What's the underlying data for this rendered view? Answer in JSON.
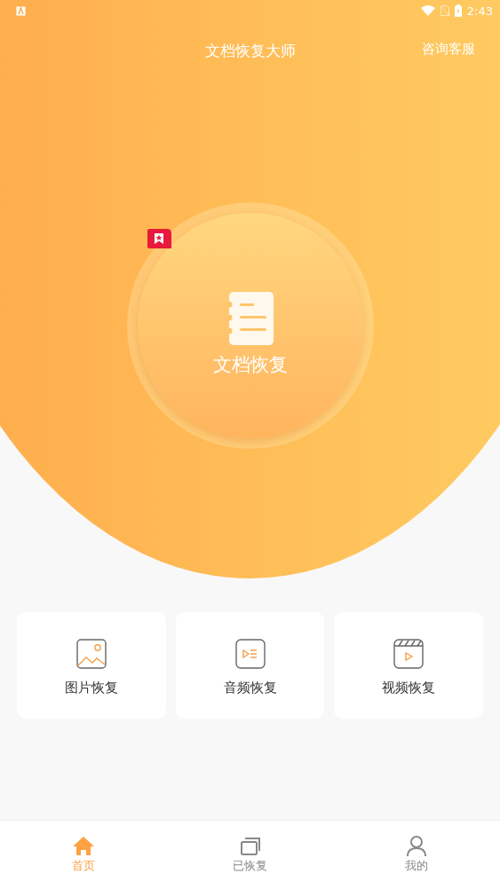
{
  "status_bar": {
    "time": "2:43"
  },
  "header": {
    "title": "文档恢复大师",
    "action": "咨询客服"
  },
  "main_action": {
    "label": "文档恢复"
  },
  "features": [
    {
      "kind": "image",
      "label": "图片恢复"
    },
    {
      "kind": "audio",
      "label": "音频恢复"
    },
    {
      "kind": "video",
      "label": "视频恢复"
    }
  ],
  "tabs": [
    {
      "kind": "home",
      "label": "首页",
      "selected": true
    },
    {
      "kind": "recovered",
      "label": "已恢复",
      "selected": false
    },
    {
      "kind": "profile",
      "label": "我的",
      "selected": false
    }
  ]
}
